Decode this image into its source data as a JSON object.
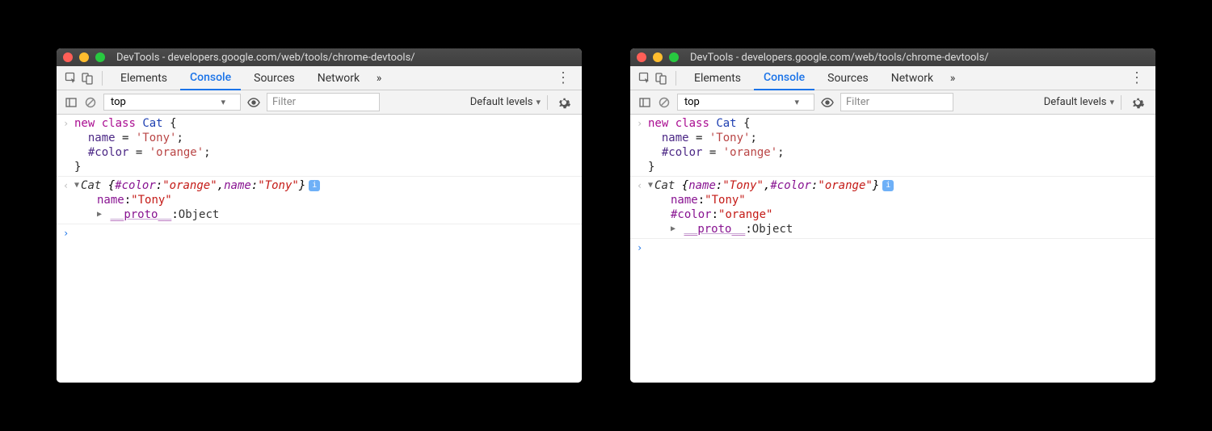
{
  "title": "DevTools - developers.google.com/web/tools/chrome-devtools/",
  "tabs": {
    "elements": "Elements",
    "console": "Console",
    "sources": "Sources",
    "network": "Network"
  },
  "toolbar": {
    "context": "top",
    "filter_placeholder": "Filter",
    "levels": "Default levels"
  },
  "code_input": {
    "line1_kw1": "new",
    "line1_kw2": "class",
    "line1_cls": "Cat",
    "line1_brace": "{",
    "line2_prop": "name",
    "line2_eq": " = ",
    "line2_val": "'Tony'",
    "line3_prop": "#color",
    "line3_eq": " = ",
    "line3_val": "'orange'",
    "line4_brace": "}"
  },
  "output_left": {
    "classname": "Cat",
    "open": "{",
    "k1": "#color",
    "v1": "\"orange\"",
    "sep": ", ",
    "k2": "name",
    "v2": "\"Tony\"",
    "close": "}",
    "child1_key": "name",
    "child1_val": "\"Tony\"",
    "proto_key": "__proto__",
    "proto_val": "Object"
  },
  "output_right": {
    "classname": "Cat",
    "open": "{",
    "k1": "name",
    "v1": "\"Tony\"",
    "sep": ", ",
    "k2": "#color",
    "v2": "\"orange\"",
    "close": "}",
    "child1_key": "name",
    "child1_val": "\"Tony\"",
    "child2_key": "#color",
    "child2_val": "\"orange\"",
    "proto_key": "__proto__",
    "proto_val": "Object"
  },
  "colon": ": "
}
